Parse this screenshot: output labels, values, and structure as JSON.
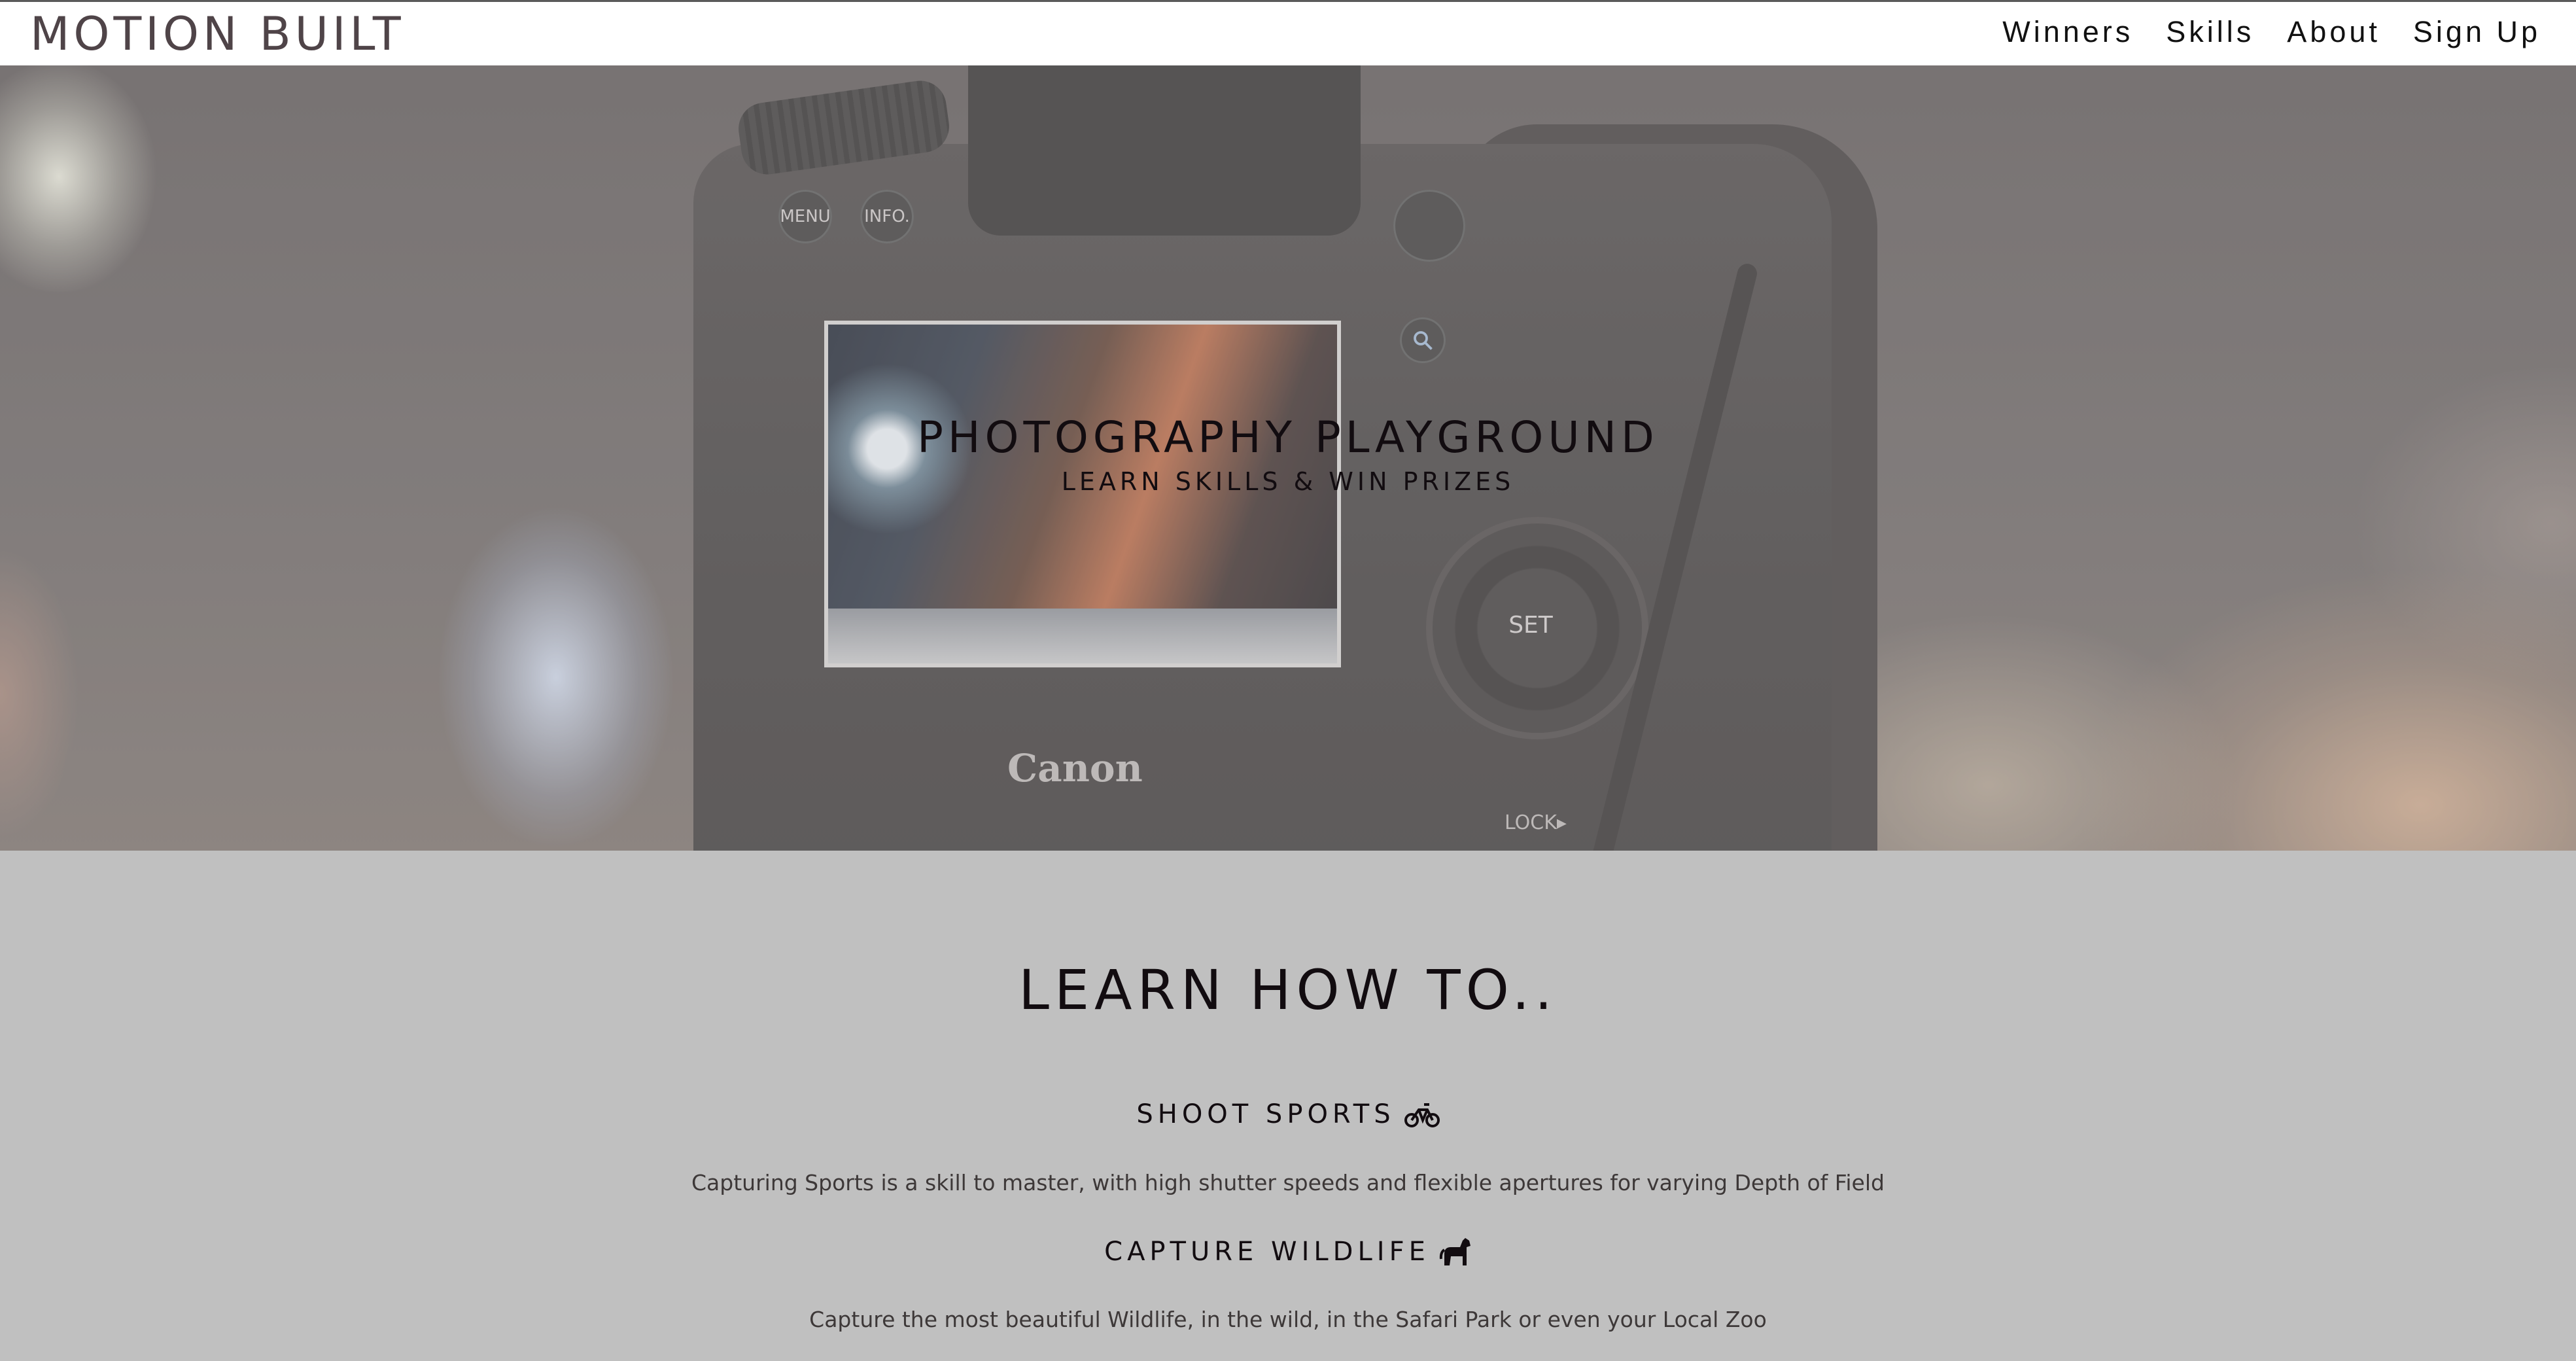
{
  "navbar": {
    "brand": "MOTION BUILT",
    "links": [
      "Winners",
      "Skills",
      "About",
      "Sign Up"
    ]
  },
  "hero": {
    "title": "PHOTOGRAPHY PLAYGROUND",
    "subtitle": "LEARN SKILLS & WIN PRIZES",
    "camera_labels": {
      "menu": "MENU",
      "info": "INFO.",
      "set": "SET",
      "brand": "Canon",
      "lock": "LOCK▸"
    }
  },
  "skills": {
    "title": "LEARN HOW TO..",
    "items": [
      {
        "heading": "SHOOT SPORTS",
        "icon": "bicycle-icon",
        "description": "Capturing Sports is a skill to master, with high shutter speeds and flexible apertures for varying Depth of Field"
      },
      {
        "heading": "CAPTURE WILDLIFE",
        "icon": "horse-icon",
        "description": "Capture the most beautiful Wildlife, in the wild, in the Safari Park or even your Local Zoo"
      }
    ]
  },
  "colors": {
    "navbar_bg": "#ffffff",
    "brand_text": "#4f4448",
    "section_bg": "#c0c0c0",
    "heading_text": "#120c10"
  }
}
